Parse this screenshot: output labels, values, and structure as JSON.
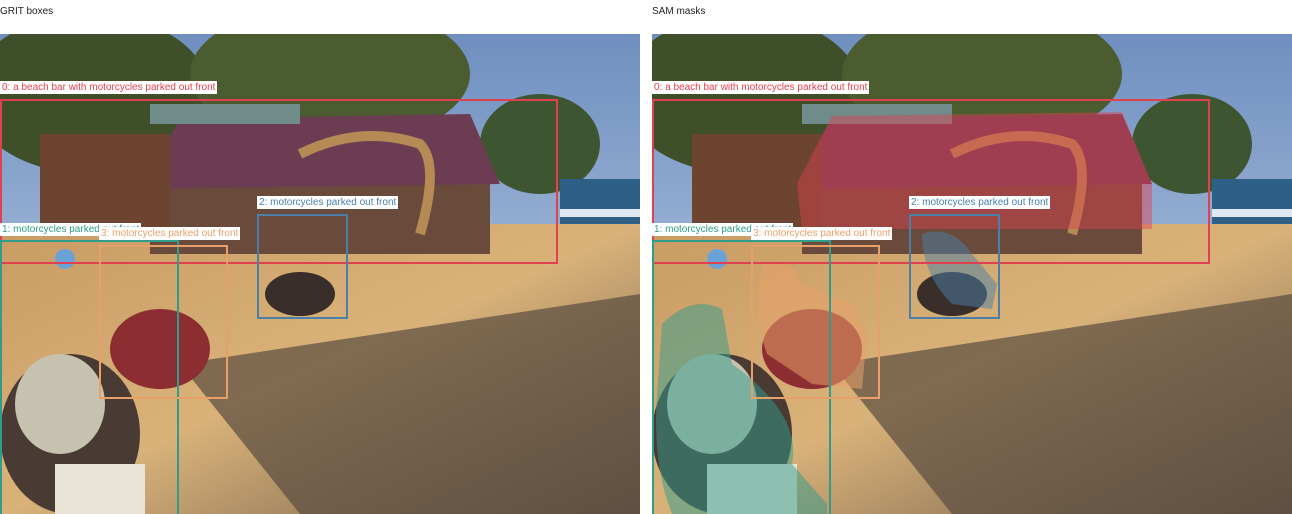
{
  "panels": [
    {
      "title": "GRIT boxes",
      "mode": "boxes",
      "labels": [
        "0: a beach bar with motorcycles parked out front",
        "1: motorcycles parked out front",
        "2: motorcycles parked out front",
        "3: motorcycles parked out front"
      ]
    },
    {
      "title": "SAM masks",
      "mode": "masks",
      "labels": [
        "0: a beach bar with motorcycles parked out front",
        "1: motorcycles parked out front",
        "2: motorcycles parked out front",
        "3: motorcycles parked out front"
      ]
    }
  ],
  "colors": {
    "region_0": "#e0404f",
    "region_1": "#2f9c8c",
    "region_2": "#4a7fa8",
    "region_3": "#e8a06a"
  },
  "scene": "beach bar with motorcycles parked out front"
}
